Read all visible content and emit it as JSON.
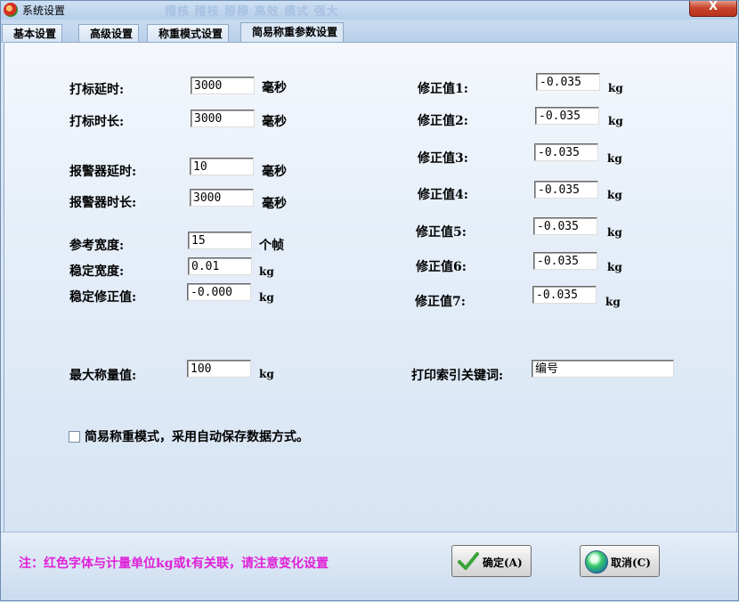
{
  "window": {
    "title": "系统设置",
    "close_label": "X",
    "ghost_text": "稽核  稽核  穆穆  高效  模式  强大"
  },
  "tabs": [
    {
      "label": "基本设置"
    },
    {
      "label": "高级设置"
    },
    {
      "label": "称重模式设置"
    },
    {
      "label": "简易称重参数设置",
      "active": true
    }
  ],
  "left": {
    "mark_delay": {
      "label": "打标延时:",
      "value": "3000",
      "unit": "毫秒"
    },
    "mark_duration": {
      "label": "打标时长:",
      "value": "3000",
      "unit": "毫秒"
    },
    "alarm_delay": {
      "label": "报警器延时:",
      "value": "10",
      "unit": "毫秒"
    },
    "alarm_duration": {
      "label": "报警器时长:",
      "value": "3000",
      "unit": "毫秒"
    },
    "ref_width": {
      "label": "参考宽度:",
      "value": "15",
      "unit": "个帧"
    },
    "stable_width": {
      "label": "稳定宽度:",
      "value": "0.01",
      "unit": "kg"
    },
    "stable_correction": {
      "label": "稳定修正值:",
      "value": "-0.000",
      "unit": "kg"
    },
    "max_weight": {
      "label": "最大称量值:",
      "value": "100",
      "unit": "kg"
    }
  },
  "corrections": [
    {
      "label": "修正值1:",
      "value": "-0.035",
      "unit": "kg"
    },
    {
      "label": "修正值2:",
      "value": "-0.035",
      "unit": "kg"
    },
    {
      "label": "修正值3:",
      "value": "-0.035",
      "unit": "kg"
    },
    {
      "label": "修正值4:",
      "value": "-0.035",
      "unit": "kg"
    },
    {
      "label": "修正值5:",
      "value": "-0.035",
      "unit": "kg"
    },
    {
      "label": "修正值6:",
      "value": "-0.035",
      "unit": "kg"
    },
    {
      "label": "修正值7:",
      "value": "-0.035",
      "unit": "kg"
    }
  ],
  "print_key": {
    "label": "打印索引关键词:",
    "value": "编号"
  },
  "simple_mode": {
    "label": "简易称重模式，采用自动保存数据方式。",
    "checked": false
  },
  "footer": {
    "note": "注：红色字体与计量单位kg或t有关联，请注意变化设置",
    "ok_label": "确定(A)",
    "cancel_label": "取消(C)"
  },
  "colors": {
    "note": "#e020d8",
    "panel": "#e7eff9"
  }
}
